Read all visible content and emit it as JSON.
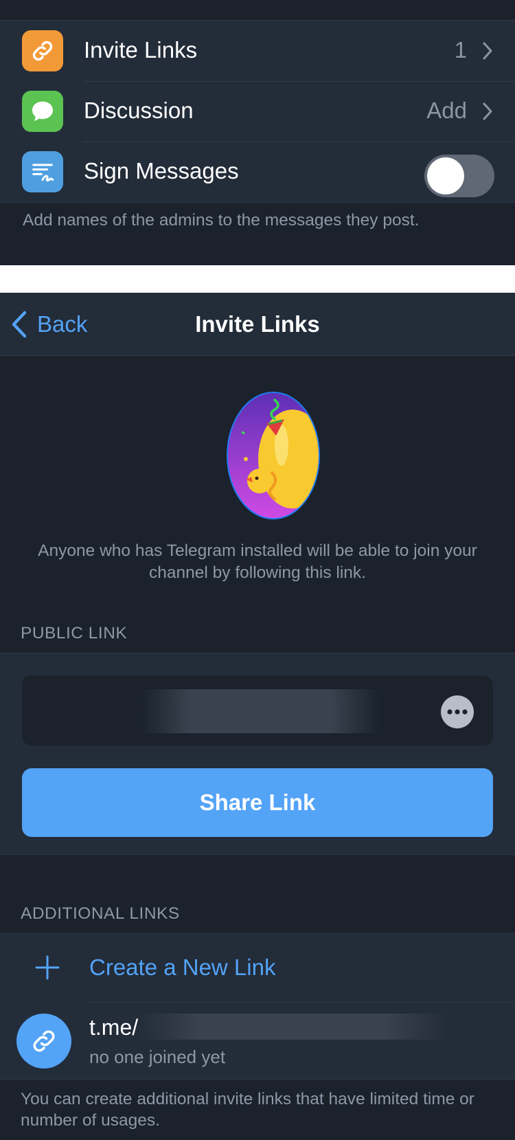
{
  "settings": {
    "invite_links": {
      "label": "Invite Links",
      "value": "1",
      "icon": "link-icon",
      "color": "#f39a38"
    },
    "discussion": {
      "label": "Discussion",
      "value": "Add",
      "icon": "speech-bubble-icon",
      "color": "#5bc352"
    },
    "sign_messages": {
      "label": "Sign Messages",
      "enabled": false,
      "icon": "signature-icon",
      "color": "#4f9fe0"
    },
    "footnote": "Add names of the admins to the messages they post."
  },
  "nav": {
    "back_label": "Back",
    "title": "Invite Links"
  },
  "intro": {
    "sticker": "party-duck-sticker",
    "description": "Anyone who has Telegram installed will be able to join your channel by following this link."
  },
  "public_link": {
    "header": "PUBLIC LINK",
    "share_label": "Share Link"
  },
  "additional_links": {
    "header": "ADDITIONAL LINKS",
    "create_label": "Create a New Link",
    "links": [
      {
        "title": "t.me/",
        "subtitle": "no one joined yet"
      }
    ],
    "footnote": "You can create additional invite links that have limited time or number of usages."
  },
  "colors": {
    "accent": "#53a3f7",
    "background": "#1b222c",
    "card": "#232c39"
  }
}
